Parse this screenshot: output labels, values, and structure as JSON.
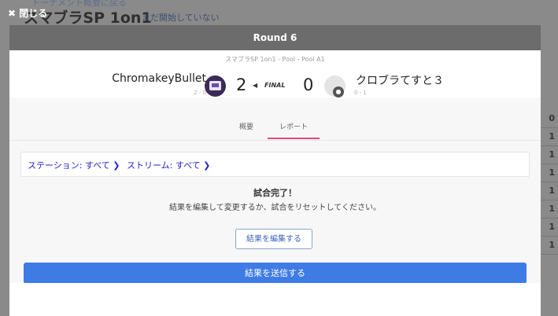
{
  "background": {
    "back_link": "トーナメント概要に戻る",
    "title": "スマブラSP 1on1",
    "status": "まだ開始していない",
    "right_column_values": [
      "0",
      "1",
      "1",
      "1",
      "1",
      "1",
      "1",
      "1"
    ]
  },
  "close_button": {
    "icon": "✖",
    "label": "閉じる"
  },
  "modal": {
    "title": "Round 6",
    "match_path": "スマブラSP 1on1 - Pool - Pool A1",
    "player1": {
      "name": "ChromakeyBullet",
      "record": "2 - 0",
      "score": "2",
      "avatar_icon": "twitch-avatar-icon"
    },
    "player2": {
      "name": "クロブラてすと３",
      "record": "0 - 1",
      "score": "0",
      "avatar_icon": "locked-avatar-icon"
    },
    "final_label": "FINAL",
    "tabs": [
      {
        "label": "概要",
        "active": false
      },
      {
        "label": "レポート",
        "active": true
      }
    ],
    "filters": {
      "station": "ステーション: すべて",
      "stream": "ストリーム: すべて"
    },
    "done_title": "試合完了！",
    "done_desc": "結果を編集して変更するか、試合をリセットしてください。",
    "edit_button": "結果を編集する",
    "submit_button": "結果を送信する"
  },
  "colors": {
    "accent_blue": "#3f7be5",
    "tab_underline": "#e8497a",
    "header_gray": "#6c6c6c",
    "link_blue": "#2222cc"
  }
}
